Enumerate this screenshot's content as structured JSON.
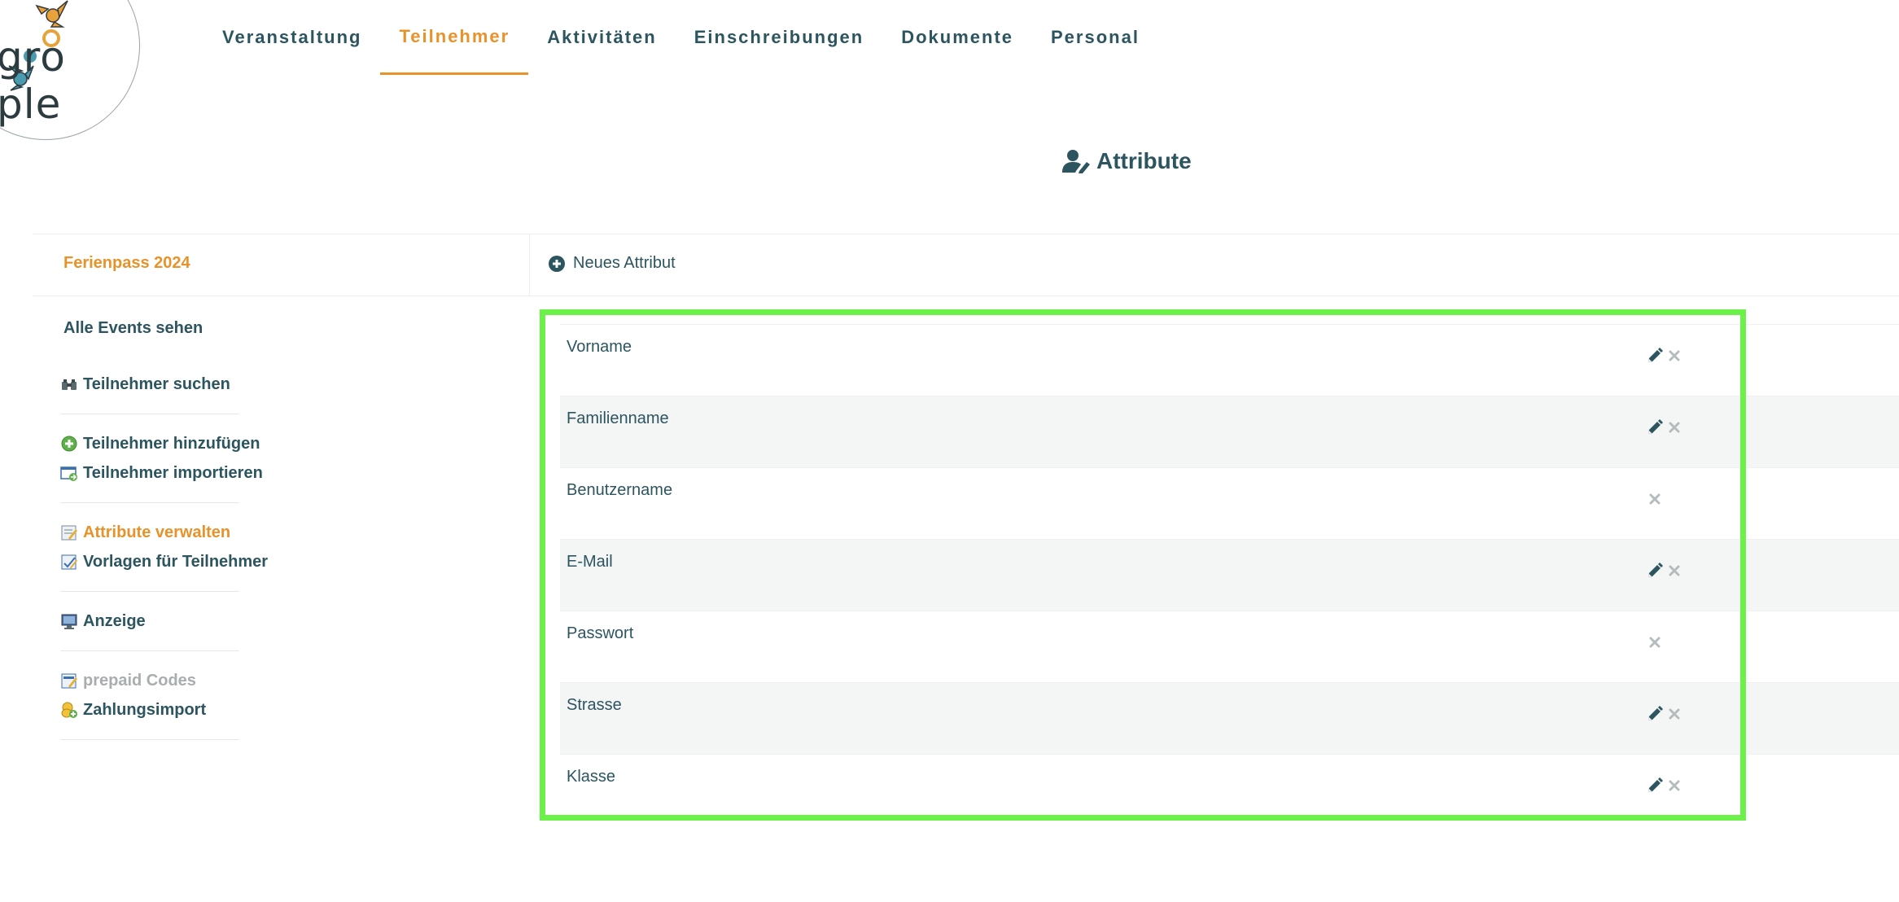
{
  "logo": {
    "text": "gro ple"
  },
  "nav": {
    "items": [
      {
        "label": "Veranstaltung"
      },
      {
        "label": "Teilnehmer"
      },
      {
        "label": "Aktivitäten"
      },
      {
        "label": "Einschreibungen"
      },
      {
        "label": "Dokumente"
      },
      {
        "label": "Personal"
      }
    ],
    "active_index": 1
  },
  "page": {
    "title": "Attribute"
  },
  "event": {
    "name": "Ferienpass 2024"
  },
  "sidebar": {
    "all_events": "Alle Events sehen",
    "search": "Teilnehmer suchen",
    "add": "Teilnehmer hinzufügen",
    "import": "Teilnehmer importieren",
    "attributes": "Attribute verwalten",
    "templates": "Vorlagen für Teilnehmer",
    "display": "Anzeige",
    "prepaid": "prepaid Codes",
    "payment_import": "Zahlungsimport"
  },
  "toolbar": {
    "new_attribute": "Neues Attribut"
  },
  "attributes": [
    {
      "name": "Vorname",
      "editable": true
    },
    {
      "name": "Familienname",
      "editable": true
    },
    {
      "name": "Benutzername",
      "editable": false
    },
    {
      "name": "E-Mail",
      "editable": true
    },
    {
      "name": "Passwort",
      "editable": false
    },
    {
      "name": "Strasse",
      "editable": true
    },
    {
      "name": "Klasse",
      "editable": true
    }
  ],
  "colors": {
    "accent": "#e8922a",
    "text": "#2c5560",
    "highlight_border": "#6cf04a"
  }
}
